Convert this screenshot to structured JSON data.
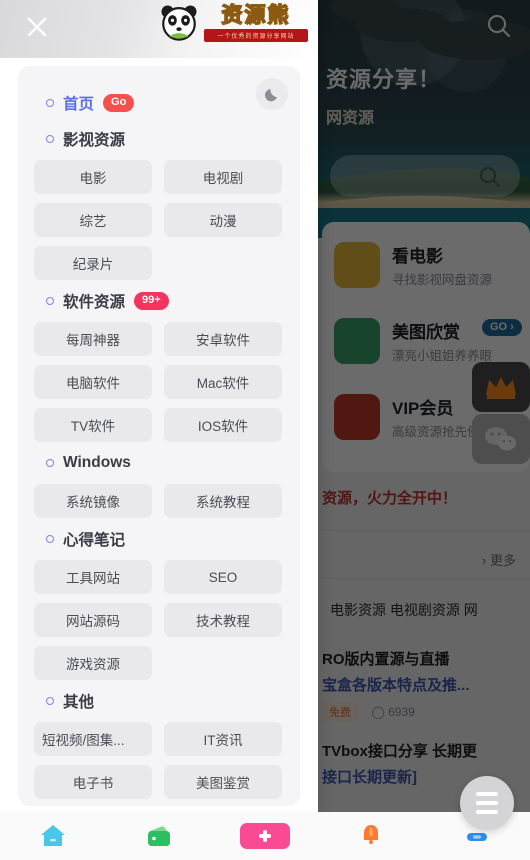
{
  "drawer": {
    "close_label": "×",
    "logo": {
      "text": "资源熊",
      "banner": "一个优秀的资源分享网站"
    },
    "theme_toggle": "☾",
    "sections": [
      {
        "title": "首页",
        "is_link": true,
        "badge": "Go",
        "badge_color": "#f5504e",
        "tiles": []
      },
      {
        "title": "影视资源",
        "is_link": false,
        "badge": "",
        "tiles": [
          "电影",
          "电视剧",
          "综艺",
          "动漫",
          "纪录片"
        ]
      },
      {
        "title": "软件资源",
        "is_link": false,
        "badge": "99+",
        "badge_color": "#f5335f",
        "tiles": [
          "每周神器",
          "安卓软件",
          "电脑软件",
          "Mac软件",
          "TV软件",
          "IOS软件"
        ]
      },
      {
        "title": "Windows",
        "is_link": false,
        "badge": "",
        "tiles": [
          "系统镜像",
          "系统教程"
        ]
      },
      {
        "title": "心得笔记",
        "is_link": false,
        "badge": "",
        "tiles": [
          "工具网站",
          "SEO",
          "网站源码",
          "技术教程",
          "游戏资源"
        ]
      },
      {
        "title": "其他",
        "is_link": false,
        "badge": "",
        "tiles": [
          "短视频/图集...",
          "IT资讯",
          "电子书",
          "美图鉴赏"
        ]
      }
    ]
  },
  "background": {
    "hero_title": "资源分享！",
    "hero_sub": "网资源",
    "search_placeholder": "",
    "cards": [
      {
        "title": "看电影",
        "subtitle": "寻找影视网盘资源",
        "badge": "",
        "thumb_color": "#e8b83a"
      },
      {
        "title": "美图欣赏",
        "subtitle": "漂亮小姐姐养养眼",
        "badge": "GO ›",
        "thumb_color": "#3aa06a"
      },
      {
        "title": "VIP会员",
        "subtitle": "高级资源抢先使用",
        "badge": "",
        "thumb_color": "#c0392b"
      }
    ],
    "marquee": "资源，火力全开中！",
    "more_label": "› 更多",
    "tags": "电影资源  电视剧资源  网",
    "articles": [
      {
        "line1": "RO版内置源与直播",
        "line2": "宝盒各版本特点及推...",
        "free": "免费",
        "views": "6939"
      },
      {
        "line1": "TVbox接口分享 长期更",
        "line2": "接口长期更新]",
        "free": "",
        "views": ""
      }
    ]
  },
  "bottom_nav": {
    "items": [
      {
        "name": "home",
        "color": "#49c6e8"
      },
      {
        "name": "wallet",
        "color": "#2cbf61"
      },
      {
        "name": "add",
        "color": "#fa4a94"
      },
      {
        "name": "bell",
        "color": "#ff7a2b"
      },
      {
        "name": "profile",
        "color": "#2b8eea"
      }
    ],
    "fab": "menu"
  }
}
